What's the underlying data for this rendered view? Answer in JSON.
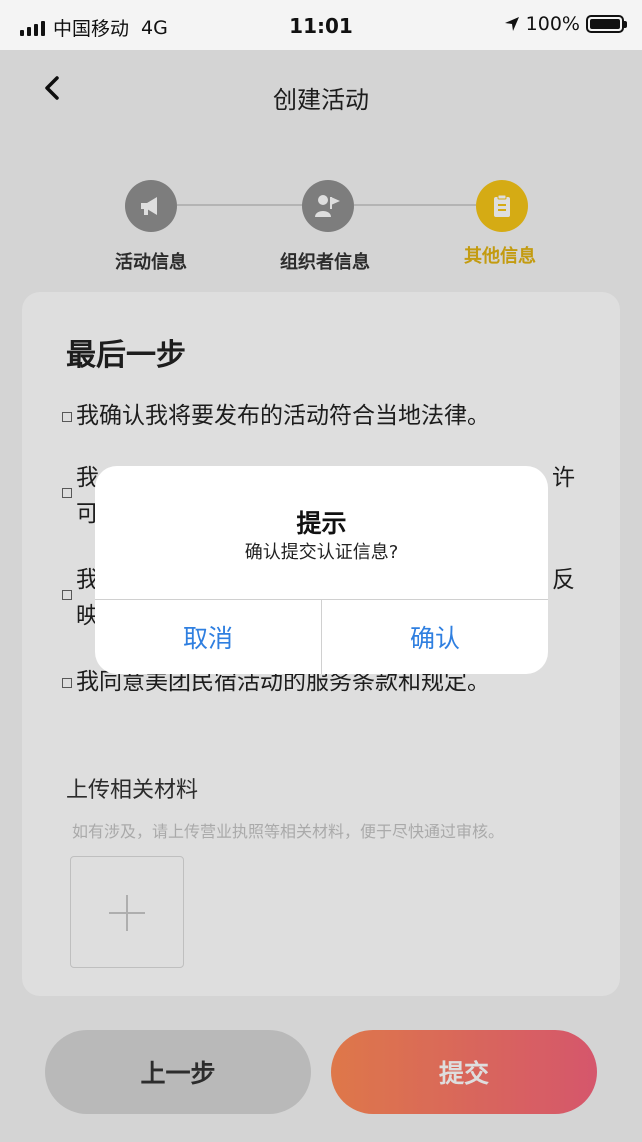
{
  "status_bar": {
    "carrier": "中国移动",
    "network": "4G",
    "time": "11:01",
    "battery": "100%",
    "battery_level": 1.0
  },
  "nav": {
    "title": "创建活动",
    "back_icon": "chevron-left-icon"
  },
  "stepper": {
    "steps": [
      {
        "label": "活动信息",
        "icon": "megaphone-icon",
        "active": false
      },
      {
        "label": "组织者信息",
        "icon": "user-flag-icon",
        "active": false
      },
      {
        "label": "其他信息",
        "icon": "clipboard-icon",
        "active": true
      }
    ],
    "active_color": "#f5c518",
    "inactive_color": "#909090"
  },
  "card": {
    "title": "最后一步",
    "agreements": [
      {
        "text": "我确认我将要发布的活动符合当地法律。"
      },
      {
        "text": "我"
      },
      {
        "text": "我"
      },
      {
        "text": "我同意美团民宿活动的服务条款和规定。"
      }
    ],
    "agreement_fragments": {
      "line2_top_right": "许",
      "line2_bottom_left": "可",
      "line3_top_right": "反",
      "line3_bottom_left": "映"
    },
    "upload": {
      "title": "上传相关材料",
      "hint": "如有涉及，请上传营业执照等相关材料，便于尽快通过审核。"
    }
  },
  "buttons": {
    "prev": "上一步",
    "submit": "提交"
  },
  "dialog": {
    "title": "提示",
    "message": "确认提交认证信息?",
    "cancel": "取消",
    "confirm": "确认",
    "button_color": "#2f7fe0"
  }
}
